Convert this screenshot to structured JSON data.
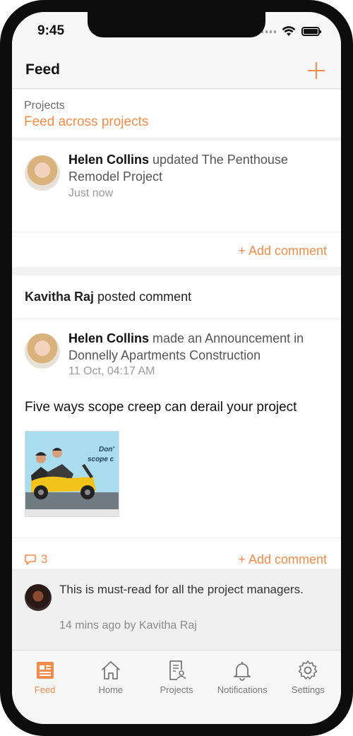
{
  "status": {
    "time": "9:45"
  },
  "nav": {
    "title": "Feed"
  },
  "projects": {
    "label": "Projects",
    "value": "Feed across projects"
  },
  "post1": {
    "author": "Helen Collins",
    "action": " updated The Penthouse Remodel Project",
    "time": "Just now",
    "add_comment": "+ Add comment"
  },
  "post2": {
    "poster": "Kavitha Raj",
    "poster_action": " posted comment",
    "author": "Helen Collins",
    "action": " made an Announcement in Donnelly Apartments Construction",
    "time": "11 Oct, 04:17 AM",
    "headline": "Five ways scope creep can derail your project",
    "thumbnail_text": "Don't scope c",
    "comment_count": "3",
    "add_comment": "+ Add comment"
  },
  "reply": {
    "text": "This is must-read for all the project managers.",
    "meta": "14 mins ago by Kavitha Raj"
  },
  "tabs": [
    {
      "label": "Feed",
      "icon": "feed-icon"
    },
    {
      "label": "Home",
      "icon": "home-icon"
    },
    {
      "label": "Projects",
      "icon": "projects-icon"
    },
    {
      "label": "Notifications",
      "icon": "bell-icon"
    },
    {
      "label": "Settings",
      "icon": "gear-icon"
    }
  ],
  "colors": {
    "accent": "#f28c4a",
    "background": "#f2f2f2"
  }
}
